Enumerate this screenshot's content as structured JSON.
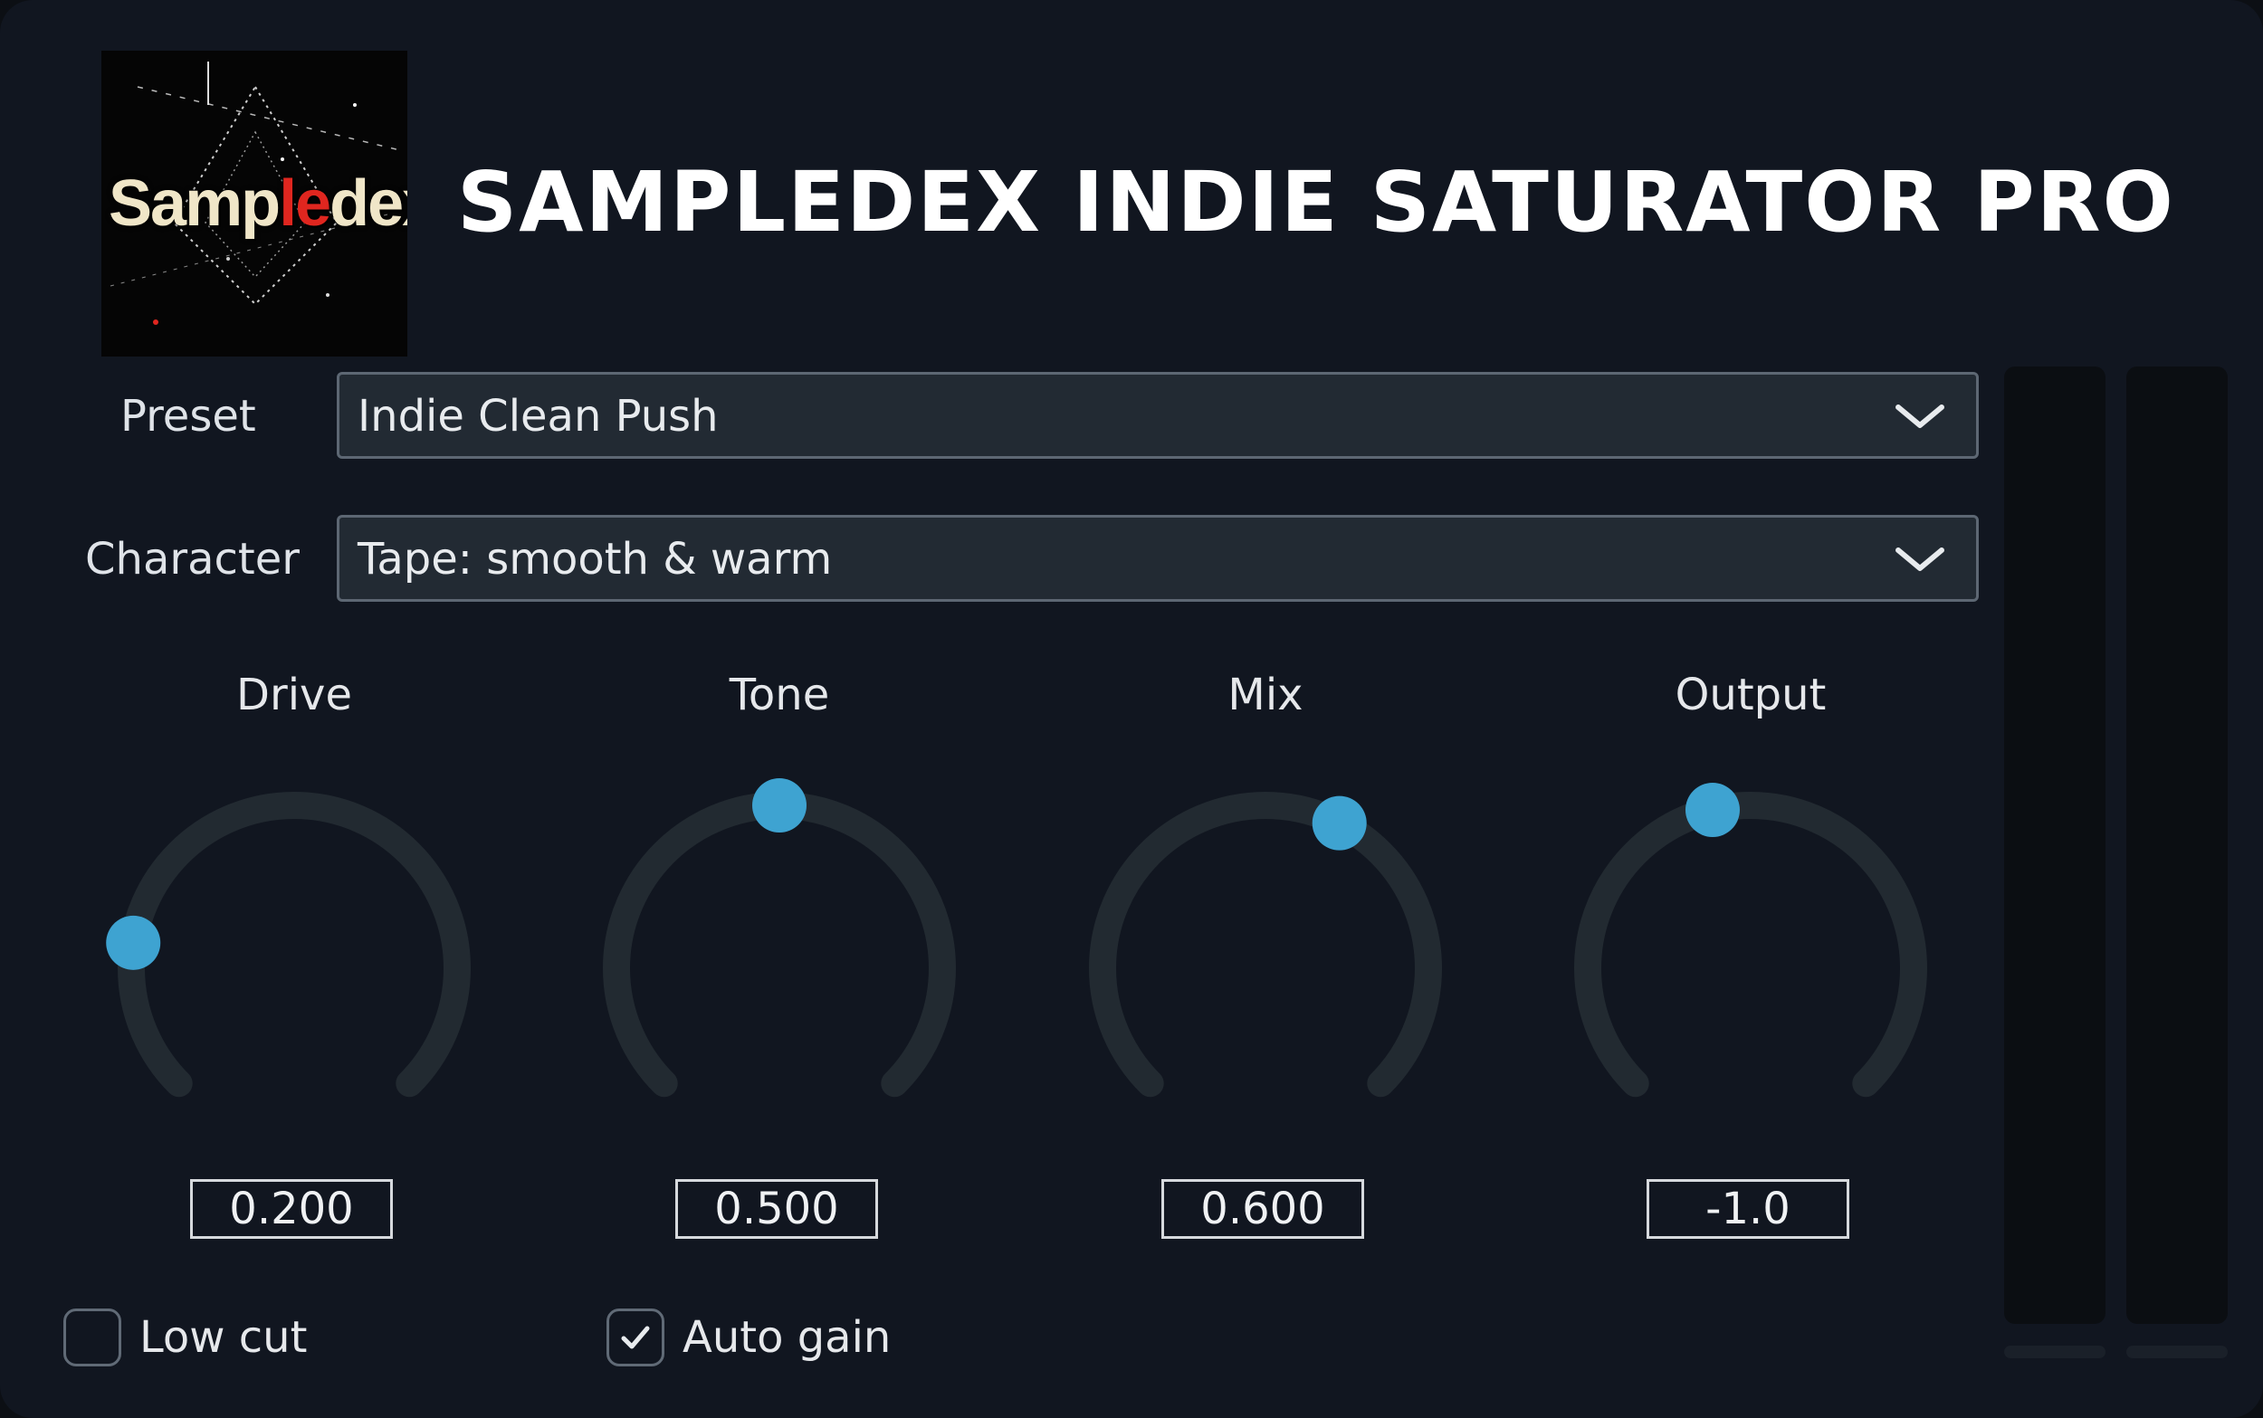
{
  "brand": {
    "logo_text_a": "Samp",
    "logo_text_b": "le",
    "logo_text_c": "dex",
    "logo_text_hl": "le"
  },
  "title": "SAMPLEDEX INDIE SATURATOR PRO",
  "preset": {
    "label": "Preset",
    "value": "Indie Clean Push"
  },
  "character": {
    "label": "Character",
    "value": "Tape: smooth & warm"
  },
  "knobs": [
    {
      "label": "Drive",
      "value": "0.200",
      "level": 0.2
    },
    {
      "label": "Tone",
      "value": "0.500",
      "level": 0.5
    },
    {
      "label": "Mix",
      "value": "0.600",
      "level": 0.6
    },
    {
      "label": "Output",
      "value": "-1.0",
      "level": 0.45
    }
  ],
  "options": {
    "low_cut": {
      "label": "Low cut",
      "checked": false
    },
    "auto_gain": {
      "label": "Auto gain",
      "checked": true
    }
  },
  "colors": {
    "accent": "#3ea3d1",
    "track": "#222a31",
    "background": "#111620"
  },
  "icons": {
    "dropdown": "chevron-down-icon",
    "check": "checkmark-icon"
  }
}
